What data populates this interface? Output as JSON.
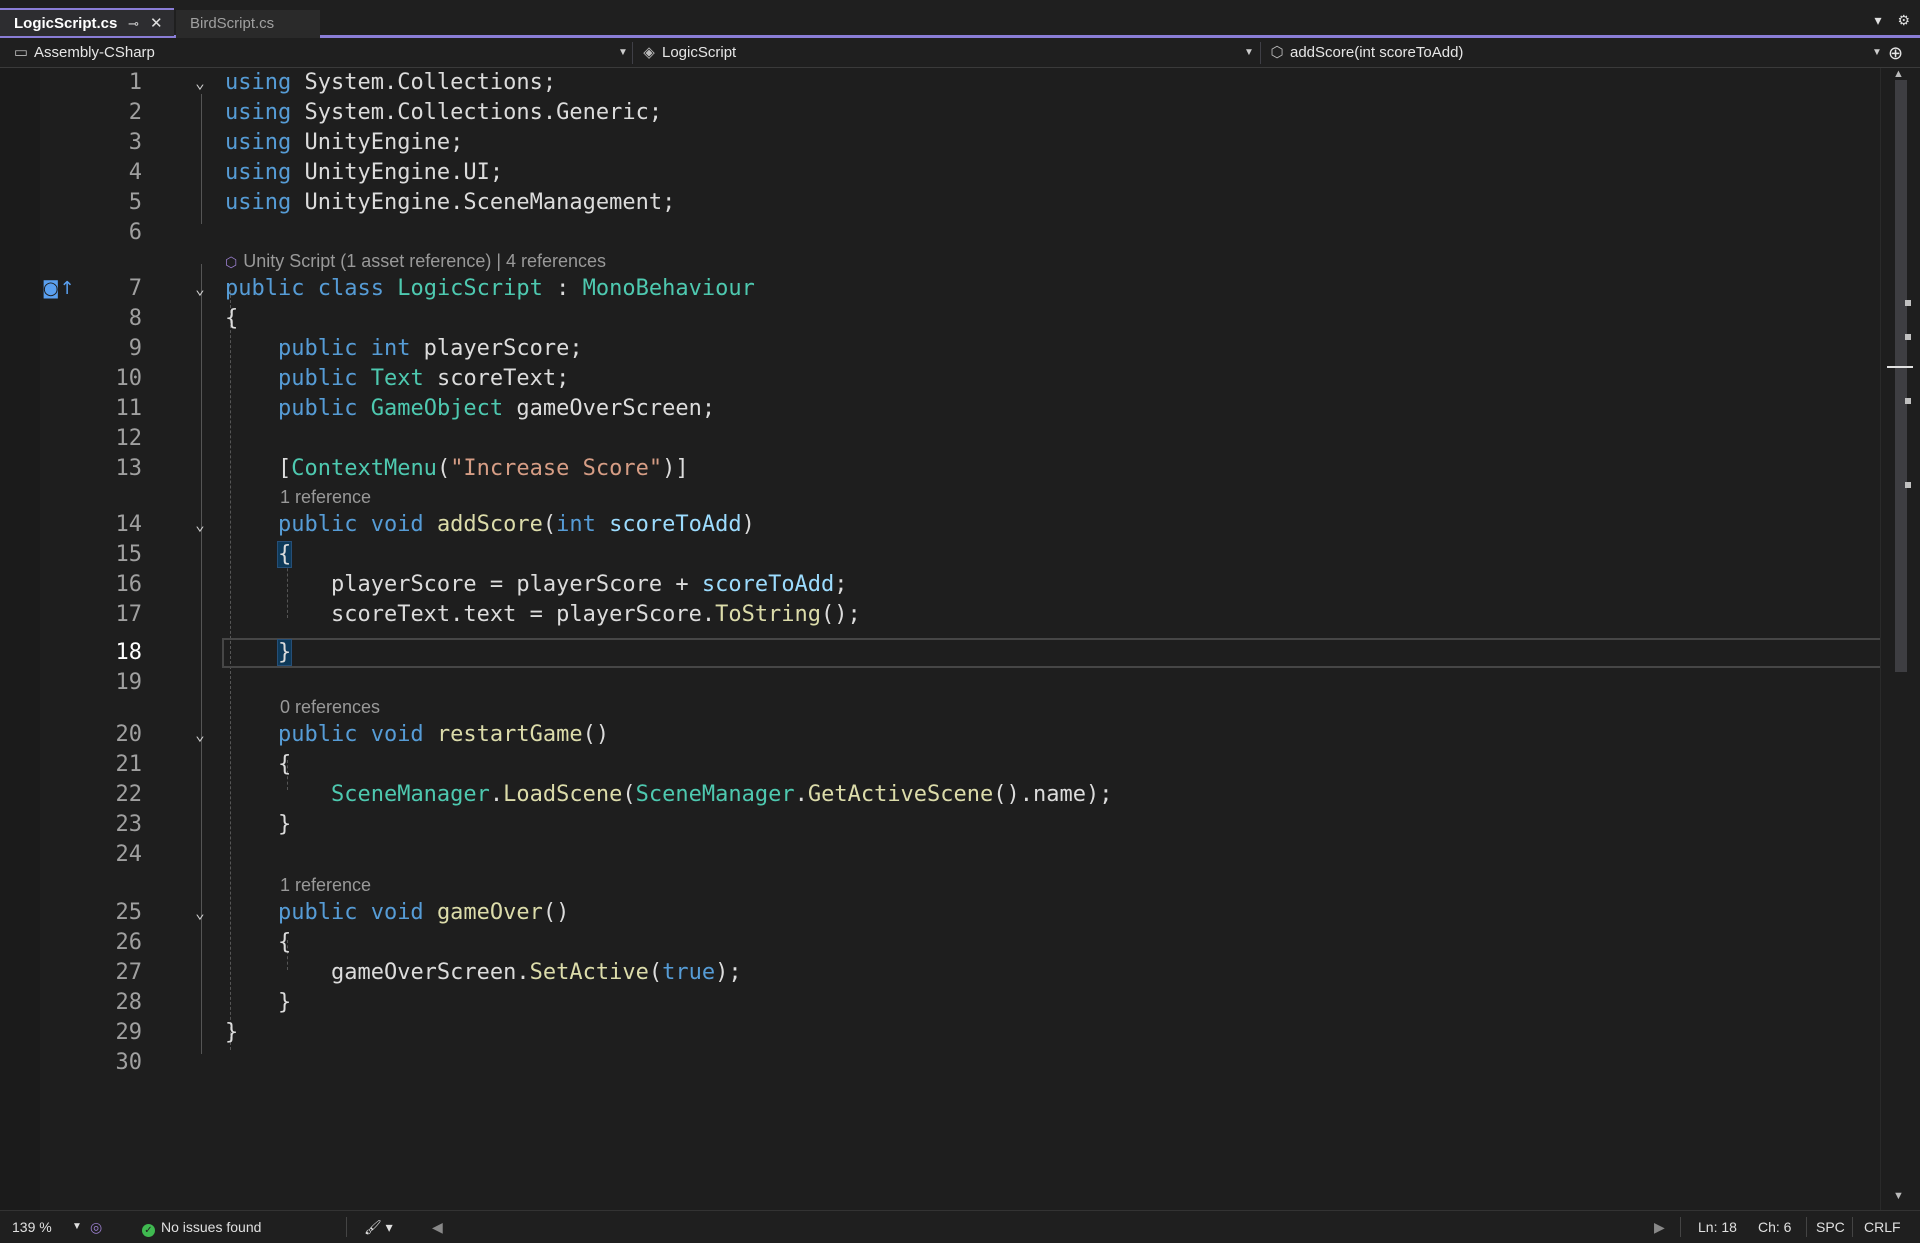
{
  "tabs": [
    {
      "label": "LogicScript.cs",
      "active": true
    },
    {
      "label": "BirdScript.cs",
      "active": false
    }
  ],
  "nav": {
    "project": "Assembly-CSharp",
    "class": "LogicScript",
    "member": "addScore(int scoreToAdd)"
  },
  "code_lens": {
    "class_lens": "Unity Script (1 asset reference) | 4 references",
    "add_score_refs": "1 reference",
    "restart_refs": "0 references",
    "game_over_refs": "1 reference"
  },
  "line_numbers": [
    "1",
    "2",
    "3",
    "4",
    "5",
    "6",
    "7",
    "8",
    "9",
    "10",
    "11",
    "12",
    "13",
    "14",
    "15",
    "16",
    "17",
    "18",
    "19",
    "20",
    "21",
    "22",
    "23",
    "24",
    "25",
    "26",
    "27",
    "28",
    "29",
    "30"
  ],
  "current_line": 18,
  "code": {
    "l1": {
      "kw": "using",
      "rest": " System.Collections;"
    },
    "l2": {
      "kw": "using",
      "rest": " System.Collections.Generic;"
    },
    "l3": {
      "kw": "using",
      "rest": " UnityEngine;"
    },
    "l4": {
      "kw": "using",
      "rest": " UnityEngine.UI;"
    },
    "l5": {
      "kw": "using",
      "rest": " UnityEngine.SceneManagement;"
    },
    "l7": {
      "kw": "public class",
      "name": "LogicScript",
      "sep": " : ",
      "base": "MonoBehaviour"
    },
    "l8": "{",
    "l9": {
      "kw": "public int",
      "rest": " playerScore;"
    },
    "l10": {
      "kw": "public",
      "type": "Text",
      "rest": " scoreText;"
    },
    "l11": {
      "kw": "public",
      "type": "GameObject",
      "rest": " gameOverScreen;"
    },
    "l13": {
      "open": "[",
      "attr": "ContextMenu",
      "p1": "(",
      "str": "\"Increase Score\"",
      "p2": ")]"
    },
    "l14": {
      "kw": "public void",
      "fn": "addScore",
      "p1": "(",
      "kw2": "int",
      "param": "scoreToAdd",
      "p2": ")"
    },
    "l15": "{",
    "l16": {
      "a": "playerScore = playerScore + ",
      "param": "scoreToAdd",
      "b": ";"
    },
    "l17": {
      "a": "scoreText.text = playerScore.",
      "fn": "ToString",
      "b": "();"
    },
    "l18": "}",
    "l20": {
      "kw": "public void",
      "fn": "restartGame",
      "p": "()"
    },
    "l21": "{",
    "l22": {
      "t1": "SceneManager",
      "dot1": ".",
      "f1": "LoadScene",
      "p1": "(",
      "t2": "SceneManager",
      "dot2": ".",
      "f2": "GetActiveScene",
      "p2": "().name);"
    },
    "l23": "}",
    "l25": {
      "kw": "public void",
      "fn": "gameOver",
      "p": "()"
    },
    "l26": "{",
    "l27": {
      "a": "gameOverScreen.",
      "fn": "SetActive",
      "p1": "(",
      "kw": "true",
      "p2": ");"
    },
    "l28": "}",
    "l29": "}"
  },
  "status": {
    "zoom": "139 %",
    "issues": "No issues found",
    "line": "Ln: 18",
    "col": "Ch: 6",
    "spacing": "SPC",
    "eol": "CRLF"
  },
  "colors": {
    "keyword": "#569cd6",
    "type": "#4ec9b0",
    "method": "#dcdcaa",
    "parameter": "#9cdcfe",
    "string": "#d69d85",
    "accent": "#8a7dd6"
  }
}
